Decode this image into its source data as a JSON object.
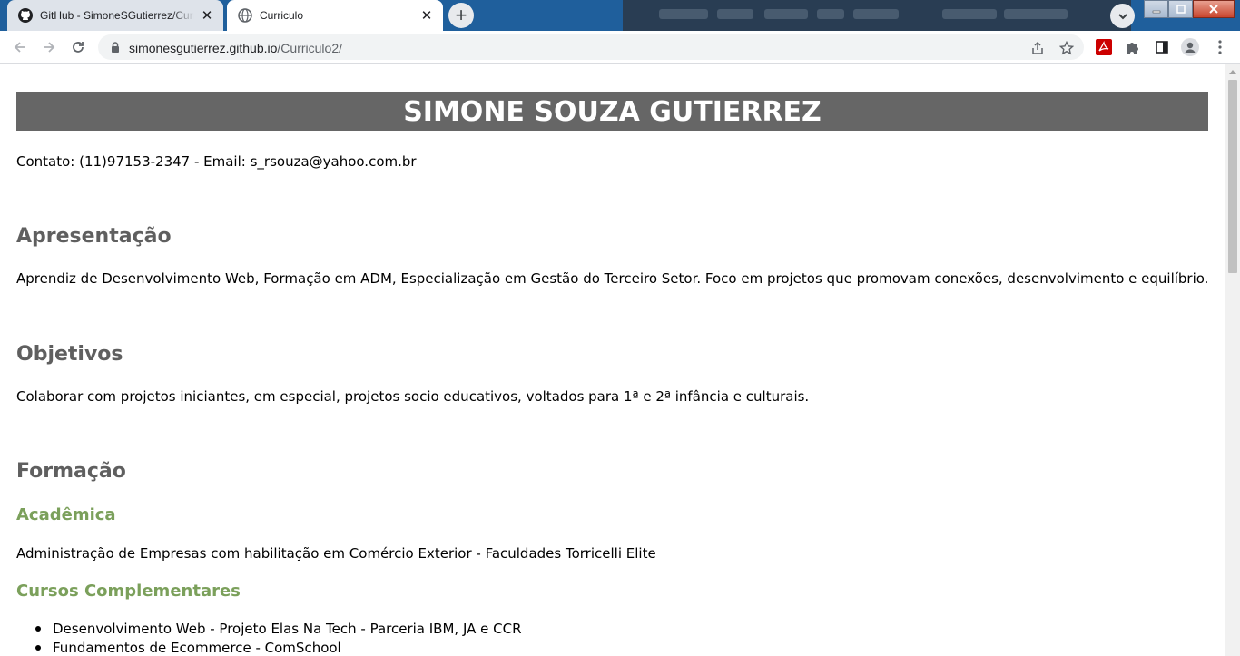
{
  "browser": {
    "tabs": [
      {
        "title": "GitHub - SimoneSGutierrez/Curriculo2",
        "active": false,
        "favicon": "github-icon"
      },
      {
        "title": "Curriculo",
        "active": true,
        "favicon": "globe-icon"
      }
    ],
    "url": {
      "host": "simonesgutierrez.github.io",
      "path": "/Curriculo2/"
    }
  },
  "page": {
    "name": "SIMONE SOUZA GUTIERREZ",
    "contact": "Contato: (11)97153-2347 - Email: s_rsouza@yahoo.com.br",
    "sections": {
      "apresentacao": {
        "heading": "Apresentação",
        "text": "Aprendiz de Desenvolvimento Web, Formação em ADM, Especialização em Gestão do Terceiro Setor. Foco em projetos que promovam conexões, desenvolvimento e equilíbrio."
      },
      "objetivos": {
        "heading": "Objetivos",
        "text": "Colaborar com projetos iniciantes, em especial, projetos socio educativos, voltados para 1ª e 2ª infância e culturais."
      },
      "formacao": {
        "heading": "Formação",
        "academica_heading": "Acadêmica",
        "academica_text": "Administração de Empresas com habilitação em Comércio Exterior - Faculdades Torricelli Elite",
        "cursos_heading": "Cursos Complementares",
        "cursos": [
          "Desenvolvimento Web - Projeto Elas Na Tech - Parceria IBM, JA e CCR",
          "Fundamentos de Ecommerce - ComSchool"
        ]
      }
    }
  },
  "colors": {
    "banner_bg": "#666666",
    "heading": "#5f5f5f",
    "subheading": "#7ba05b"
  }
}
